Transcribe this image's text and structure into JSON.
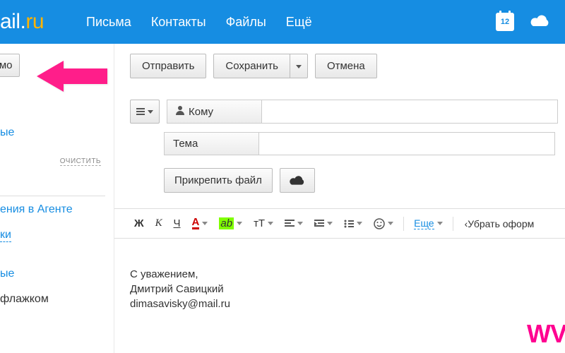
{
  "header": {
    "logo_main": "ail",
    "logo_dot": ".",
    "logo_ru": "ru",
    "nav": [
      "Письма",
      "Контакты",
      "Файлы",
      "Ещё"
    ],
    "calendar_day": "12"
  },
  "sidebar": {
    "compose": "ьмо",
    "links": {
      "l1": "ые",
      "clear": "очистить",
      "l2": "ения в Агенте",
      "l3": "ки",
      "l4": "ые",
      "l5": "флажком"
    }
  },
  "toolbar": {
    "send": "Отправить",
    "save": "Сохранить",
    "cancel": "Отмена"
  },
  "fields": {
    "to_label": "Кому",
    "subject_label": "Тема",
    "attach": "Прикрепить файл"
  },
  "editor": {
    "bold": "Ж",
    "italic": "К",
    "underline": "Ч",
    "color": "А",
    "highlight": "ab",
    "size": "тT",
    "more": "Еще",
    "remove_format": "Убрать оформ"
  },
  "body": {
    "line1": "С уважением,",
    "line2": "Дмитрий Савицкий",
    "line3": "dimasavisky@mail.ru"
  },
  "watermark": "WV"
}
